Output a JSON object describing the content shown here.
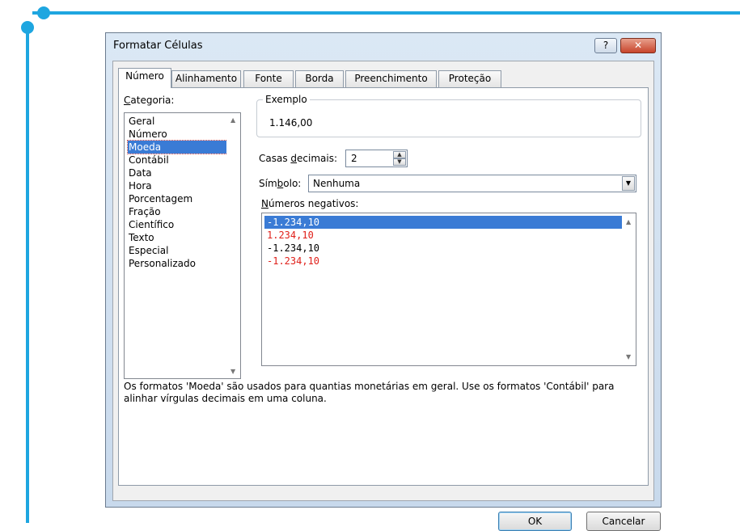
{
  "window": {
    "title": "Formatar Células",
    "help_glyph": "?",
    "close_glyph": "✕"
  },
  "tabs": [
    {
      "label": "Número"
    },
    {
      "label": "Alinhamento"
    },
    {
      "label": "Fonte"
    },
    {
      "label": "Borda"
    },
    {
      "label": "Preenchimento"
    },
    {
      "label": "Proteção"
    }
  ],
  "category": {
    "label_prefix": "",
    "label_mnemonic": "C",
    "label_rest": "ategoria:",
    "items": [
      "Geral",
      "Número",
      "Moeda",
      "Contábil",
      "Data",
      "Hora",
      "Porcentagem",
      "Fração",
      "Científico",
      "Texto",
      "Especial",
      "Personalizado"
    ],
    "selected": "Moeda"
  },
  "example": {
    "title": "Exemplo",
    "value": "1.146,00"
  },
  "decimals": {
    "label_prefix": "Casas ",
    "label_mnemonic": "d",
    "label_rest": "ecimais:",
    "value": "2"
  },
  "symbol": {
    "label_prefix": "Sím",
    "label_mnemonic": "b",
    "label_rest": "olo:",
    "value": "Nenhuma"
  },
  "negatives": {
    "label_prefix": "",
    "label_mnemonic": "N",
    "label_rest": "úmeros negativos:",
    "items": [
      "-1.234,10",
      "1.234,10",
      "-1.234,10",
      "-1.234,10"
    ],
    "selected_index": 0,
    "red_indices": [
      1,
      3
    ]
  },
  "description": "Os formatos 'Moeda' são usados para quantias monetárias em geral. Use os formatos 'Contábil' para alinhar vírgulas decimais em uma coluna.",
  "buttons": {
    "ok": "OK",
    "cancel": "Cancelar"
  },
  "colors": {
    "callout": "#1ea6e0",
    "selection": "#3a7bd5",
    "negative_red": "#e0201a"
  }
}
